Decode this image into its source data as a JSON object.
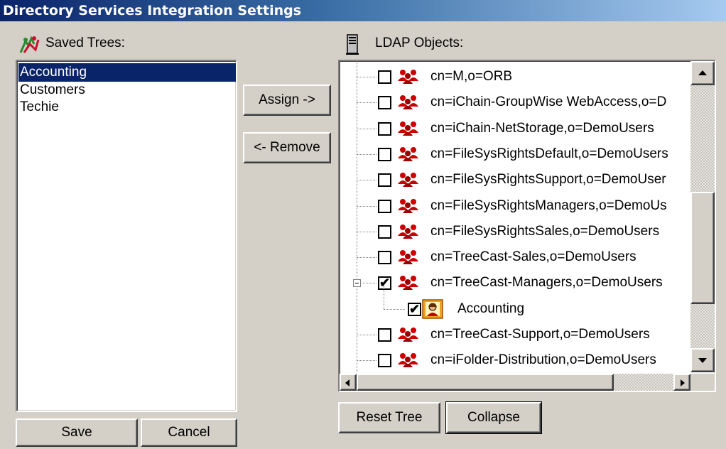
{
  "window": {
    "title": "Directory Services Integration Settings"
  },
  "saved_trees": {
    "label": "Saved Trees:",
    "items": [
      "Accounting",
      "Customers",
      "Techie"
    ],
    "selected": "Accounting"
  },
  "ldap": {
    "label": "LDAP Objects:",
    "nodes": [
      {
        "text": "cn=M,o=ORB",
        "checked": false
      },
      {
        "text": "cn=iChain-GroupWise WebAccess,o=D",
        "checked": false
      },
      {
        "text": "cn=iChain-NetStorage,o=DemoUsers",
        "checked": false
      },
      {
        "text": "cn=FileSysRightsDefault,o=DemoUsers",
        "checked": false
      },
      {
        "text": "cn=FileSysRightsSupport,o=DemoUser",
        "checked": false
      },
      {
        "text": "cn=FileSysRightsManagers,o=DemoUs",
        "checked": false
      },
      {
        "text": "cn=FileSysRightsSales,o=DemoUsers",
        "checked": false
      },
      {
        "text": "cn=TreeCast-Sales,o=DemoUsers",
        "checked": false
      },
      {
        "text": "cn=TreeCast-Managers,o=DemoUsers",
        "checked": true,
        "expanded": true
      },
      {
        "text": "Accounting",
        "checked": true,
        "child": true
      },
      {
        "text": "cn=TreeCast-Support,o=DemoUsers",
        "checked": false
      },
      {
        "text": "cn=iFolder-Distribution,o=DemoUsers",
        "checked": false
      }
    ]
  },
  "buttons": {
    "assign": "Assign ->",
    "remove": "<- Remove",
    "save": "Save",
    "cancel": "Cancel",
    "reset_tree": "Reset Tree",
    "collapse": "Collapse"
  },
  "icons": {
    "saved_trees": "saved-trees-icon",
    "ldap": "server-icon",
    "group": "group-icon",
    "org_unit": "org-unit-icon"
  },
  "colors": {
    "title_gradient_start": "#0a246a",
    "title_gradient_end": "#a6caf0",
    "selection": "#0a246a",
    "group_icon": "#cc0000"
  }
}
